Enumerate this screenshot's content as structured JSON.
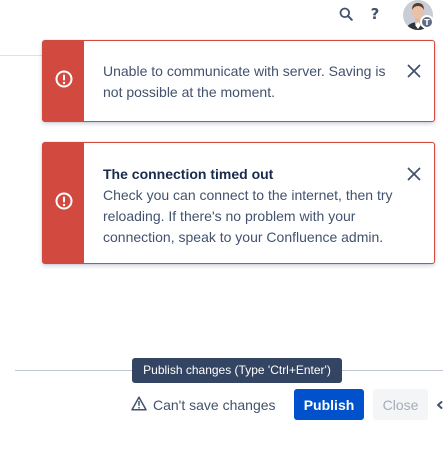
{
  "header": {
    "search_icon": "search-icon",
    "help_label": "?",
    "avatar_badge_letter": "T"
  },
  "flags": [
    {
      "type": "error",
      "icon": "error-icon",
      "title": "",
      "message": "Unable to communicate with server. Saving is not possible at the moment."
    },
    {
      "type": "error",
      "icon": "error-icon",
      "title": "The connection timed out",
      "message": "Check you can connect to the internet, then try reloading. If there's no problem with your connection, speak to your Confluence admin."
    }
  ],
  "footer": {
    "tooltip": "Publish changes (Type 'Ctrl+Enter')",
    "status_text": "Can't save changes",
    "publish_label": "Publish",
    "close_label": "Close"
  },
  "colors": {
    "error": "#d24a3f",
    "primary": "#0052cc",
    "tooltip_bg": "#344563"
  }
}
